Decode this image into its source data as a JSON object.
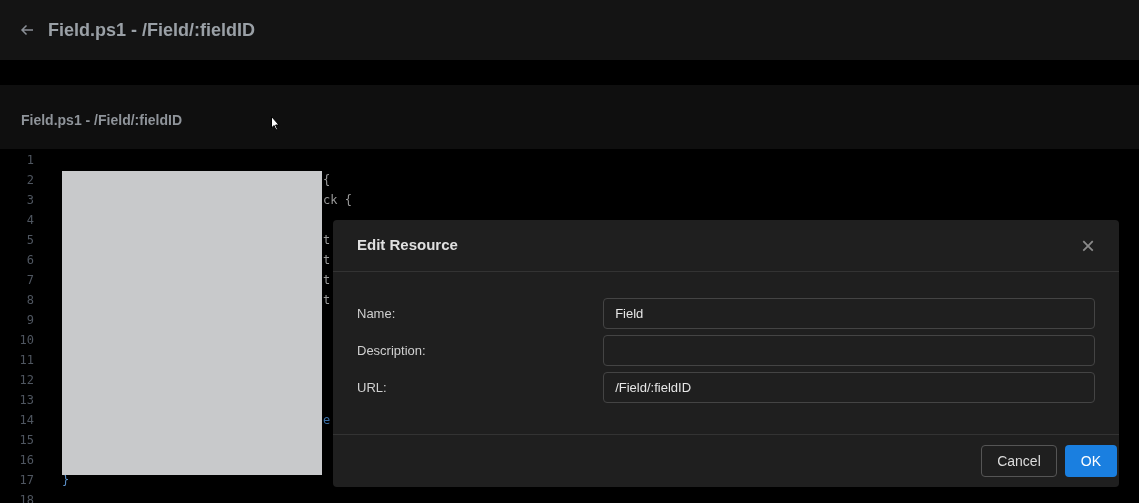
{
  "header": {
    "title": "Field.ps1 - /Field/:fieldID"
  },
  "panel": {
    "title": "Field.ps1 - /Field/:fieldID"
  },
  "editor": {
    "lines": [
      {
        "number": "1"
      },
      {
        "number": "2",
        "kind": "after_redaction",
        "text": "{"
      },
      {
        "number": "3",
        "kind": "after_redaction",
        "text": "ck {"
      },
      {
        "number": "4"
      },
      {
        "number": "5",
        "kind": "after_redaction",
        "text": "t"
      },
      {
        "number": "6",
        "kind": "after_redaction",
        "text": "t"
      },
      {
        "number": "7",
        "kind": "after_redaction",
        "text": "t"
      },
      {
        "number": "8",
        "kind": "after_redaction",
        "text": "t"
      },
      {
        "number": "9"
      },
      {
        "number": "10"
      },
      {
        "number": "11"
      },
      {
        "number": "12"
      },
      {
        "number": "13"
      },
      {
        "number": "14",
        "kind": "after_redaction_keyword",
        "text": "e"
      },
      {
        "number": "15"
      },
      {
        "number": "16"
      },
      {
        "number": "17",
        "kind": "plain",
        "text": "}"
      },
      {
        "number": "18"
      }
    ]
  },
  "dialog": {
    "title": "Edit Resource",
    "close": "×",
    "fields": [
      {
        "label": "Name:",
        "value": "Field"
      },
      {
        "label": "Description:"
      },
      {
        "label": "URL:",
        "value": "/Field/:fieldID"
      }
    ],
    "buttons": [
      {
        "label": "Cancel",
        "kind": "secondary"
      },
      {
        "label": "OK",
        "kind": "primary"
      }
    ]
  }
}
